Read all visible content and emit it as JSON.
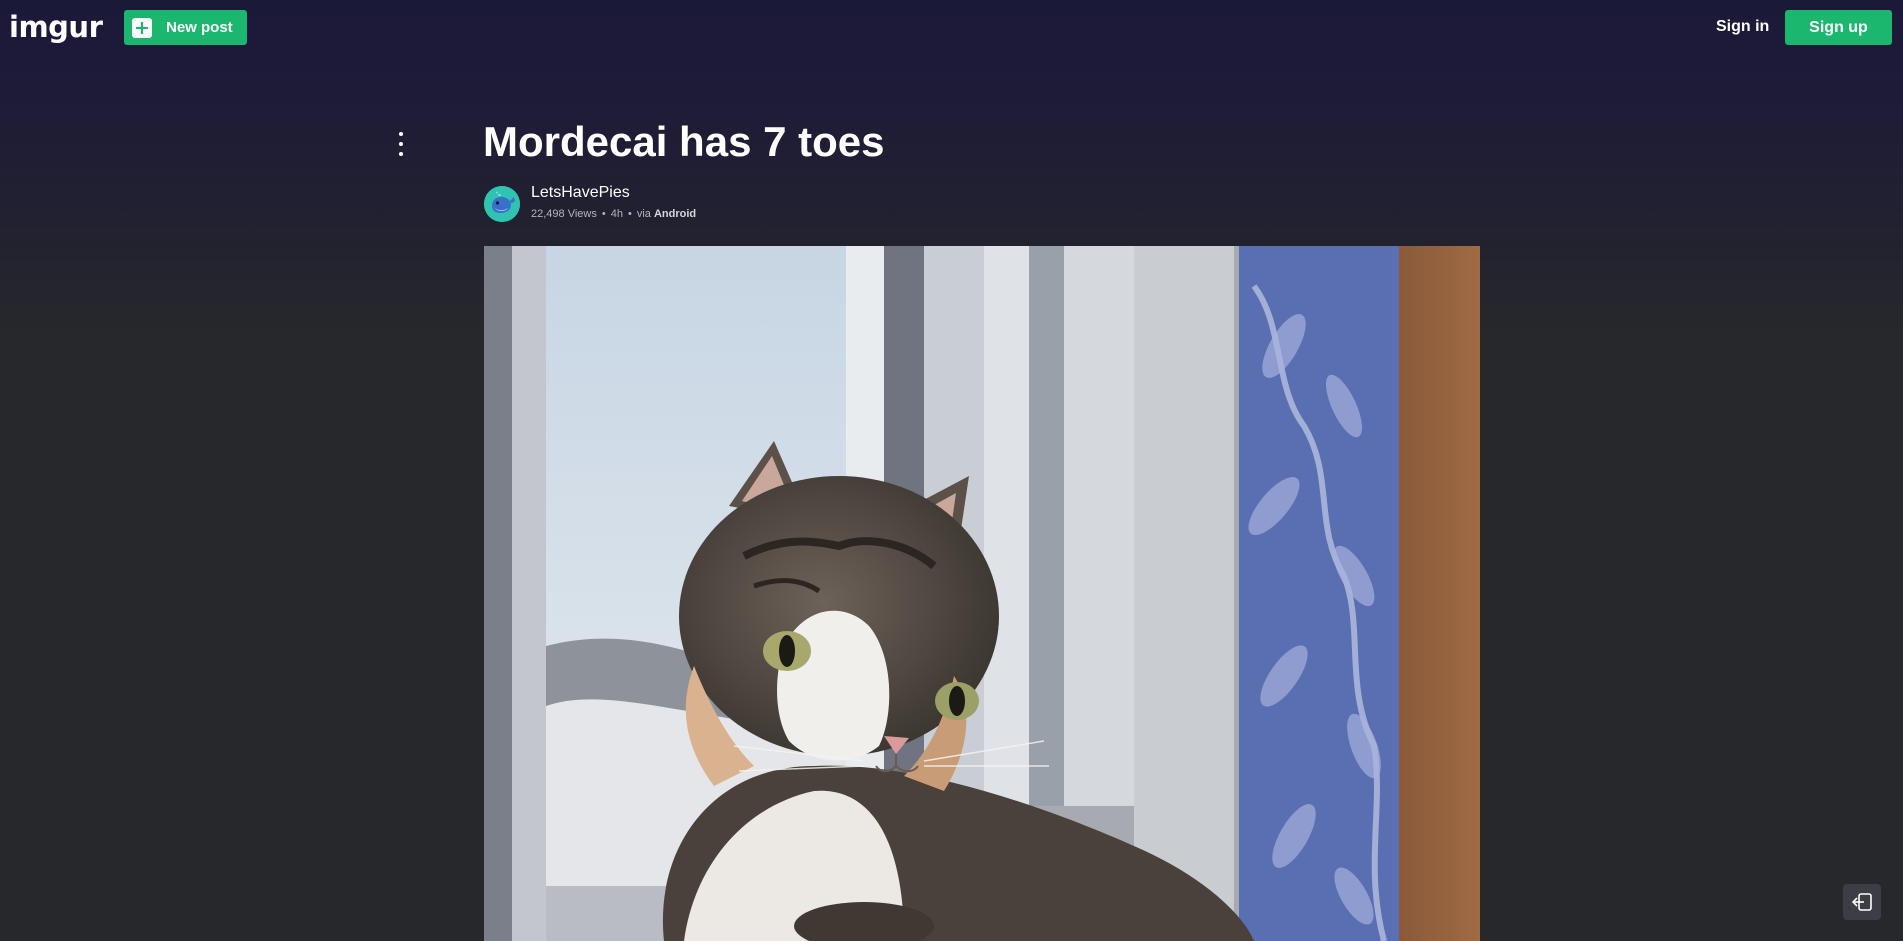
{
  "header": {
    "logo_text": "imgur",
    "new_post_label": "New post",
    "sign_in_label": "Sign in",
    "sign_up_label": "Sign up"
  },
  "post": {
    "title": "Mordecai has 7 toes",
    "author": "LetsHavePies",
    "views": "22,498 Views",
    "age": "4h",
    "via_prefix": "via",
    "via_platform": "Android"
  },
  "icons": {
    "more": "kebab-vertical-icon",
    "new_post": "plus-square-icon",
    "avatar": "whale-avatar-icon",
    "bottom_button": "exit-arrow-icon"
  },
  "colors": {
    "accent": "#1bb76e",
    "header_bg": "#1b1938",
    "page_bg": "#27282c",
    "avatar_bg": "#2fc4b2"
  }
}
